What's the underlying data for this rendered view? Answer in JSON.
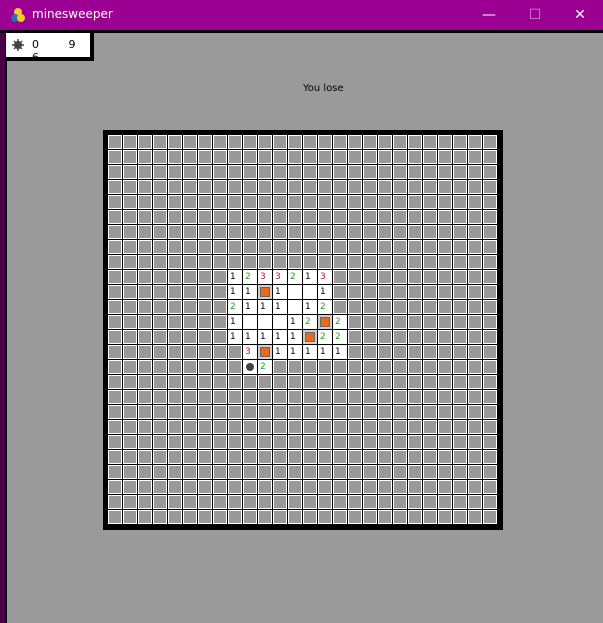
{
  "window": {
    "title": "minesweeper",
    "minimize_glyph": "—",
    "maximize_glyph": "☐",
    "close_glyph": "✕"
  },
  "counter": {
    "digits": "0 9 6"
  },
  "status": {
    "text": "You lose"
  },
  "board": {
    "rows": 26,
    "cols": 26,
    "revealed": [
      {
        "r": 9,
        "c": 8,
        "t": "1",
        "color": "#000000"
      },
      {
        "r": 9,
        "c": 9,
        "t": "2",
        "color": "#2a9d2a"
      },
      {
        "r": 9,
        "c": 10,
        "t": "3",
        "color": "#c2182b"
      },
      {
        "r": 9,
        "c": 11,
        "t": "3",
        "color": "#c2182b"
      },
      {
        "r": 9,
        "c": 12,
        "t": "2",
        "color": "#2a9d2a"
      },
      {
        "r": 9,
        "c": 13,
        "t": "1",
        "color": "#000000"
      },
      {
        "r": 9,
        "c": 14,
        "t": "3",
        "color": "#c2182b"
      },
      {
        "r": 10,
        "c": 8,
        "t": "1",
        "color": "#000000"
      },
      {
        "r": 10,
        "c": 9,
        "t": "1",
        "color": "#000000"
      },
      {
        "r": 10,
        "c": 10,
        "t": "flag",
        "color": "#e86b1c"
      },
      {
        "r": 10,
        "c": 11,
        "t": "1",
        "color": "#000000"
      },
      {
        "r": 10,
        "c": 12,
        "t": "",
        "color": "#000000"
      },
      {
        "r": 10,
        "c": 13,
        "t": "",
        "color": "#000000"
      },
      {
        "r": 10,
        "c": 14,
        "t": "1",
        "color": "#000000"
      },
      {
        "r": 11,
        "c": 8,
        "t": "2",
        "color": "#2a9d2a"
      },
      {
        "r": 11,
        "c": 9,
        "t": "1",
        "color": "#000000"
      },
      {
        "r": 11,
        "c": 10,
        "t": "1",
        "color": "#000000"
      },
      {
        "r": 11,
        "c": 11,
        "t": "1",
        "color": "#000000"
      },
      {
        "r": 11,
        "c": 12,
        "t": "",
        "color": "#000000"
      },
      {
        "r": 11,
        "c": 13,
        "t": "1",
        "color": "#000000"
      },
      {
        "r": 11,
        "c": 14,
        "t": "2",
        "color": "#2a9d2a"
      },
      {
        "r": 12,
        "c": 8,
        "t": "1",
        "color": "#000000"
      },
      {
        "r": 12,
        "c": 9,
        "t": "",
        "color": "#000000"
      },
      {
        "r": 12,
        "c": 10,
        "t": "",
        "color": "#000000"
      },
      {
        "r": 12,
        "c": 11,
        "t": "",
        "color": "#000000"
      },
      {
        "r": 12,
        "c": 12,
        "t": "1",
        "color": "#000000"
      },
      {
        "r": 12,
        "c": 13,
        "t": "2",
        "color": "#2a9d2a"
      },
      {
        "r": 12,
        "c": 14,
        "t": "flag",
        "color": "#e86b1c"
      },
      {
        "r": 12,
        "c": 15,
        "t": "2",
        "color": "#2a9d2a"
      },
      {
        "r": 13,
        "c": 8,
        "t": "1",
        "color": "#000000"
      },
      {
        "r": 13,
        "c": 9,
        "t": "1",
        "color": "#000000"
      },
      {
        "r": 13,
        "c": 10,
        "t": "1",
        "color": "#000000"
      },
      {
        "r": 13,
        "c": 11,
        "t": "1",
        "color": "#000000"
      },
      {
        "r": 13,
        "c": 12,
        "t": "1",
        "color": "#000000"
      },
      {
        "r": 13,
        "c": 13,
        "t": "flag",
        "color": "#e86b1c"
      },
      {
        "r": 13,
        "c": 14,
        "t": "2",
        "color": "#2a9d2a"
      },
      {
        "r": 13,
        "c": 15,
        "t": "2",
        "color": "#2a9d2a"
      },
      {
        "r": 14,
        "c": 9,
        "t": "3",
        "color": "#c2182b"
      },
      {
        "r": 14,
        "c": 10,
        "t": "flag",
        "color": "#e86b1c"
      },
      {
        "r": 14,
        "c": 11,
        "t": "1",
        "color": "#000000"
      },
      {
        "r": 14,
        "c": 12,
        "t": "1",
        "color": "#000000"
      },
      {
        "r": 14,
        "c": 13,
        "t": "1",
        "color": "#000000"
      },
      {
        "r": 14,
        "c": 14,
        "t": "1",
        "color": "#000000"
      },
      {
        "r": 14,
        "c": 15,
        "t": "1",
        "color": "#000000"
      },
      {
        "r": 15,
        "c": 9,
        "t": "mine",
        "color": "#333333"
      },
      {
        "r": 15,
        "c": 10,
        "t": "2",
        "color": "#2a9d2a"
      }
    ]
  }
}
